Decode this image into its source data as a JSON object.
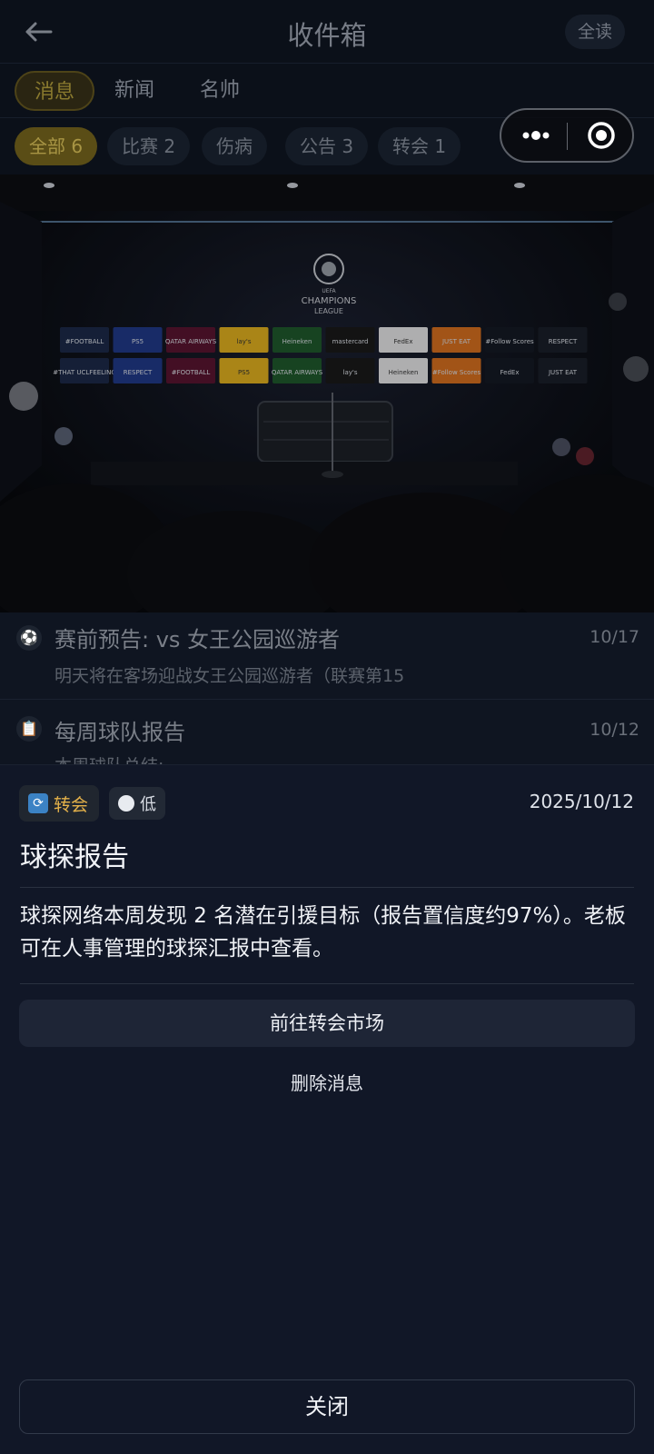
{
  "header": {
    "title": "收件箱",
    "read_all": "全读"
  },
  "tabs": [
    {
      "label": "消息",
      "active": true
    },
    {
      "label": "新闻",
      "active": false
    },
    {
      "label": "名帅",
      "active": false
    }
  ],
  "filters": [
    {
      "label": "全部 6",
      "active": true
    },
    {
      "label": "比赛 2",
      "active": false
    },
    {
      "label": "伤病",
      "active": false
    },
    {
      "label": "公告 3",
      "active": false
    },
    {
      "label": "转会 1",
      "active": false
    }
  ],
  "hero": {
    "league_line1": "UEFA",
    "league_line2": "CHAMPIONS",
    "league_line3": "LEAGUE",
    "sponsors_row1": [
      "#FOOTBALL",
      "PS5",
      "QATAR AIRWAYS",
      "lay's",
      "Heineken",
      "mastercard",
      "FedEx",
      "JUST EAT",
      "#Follow Scores",
      "RESPECT"
    ],
    "sponsors_row2": [
      "#THAT UCLFEELING",
      "RESPECT",
      "#FOOTBALL",
      "PS5",
      "QATAR AIRWAYS",
      "lay's",
      "Heineken",
      "#Follow Scores",
      "FedEx",
      "JUST EAT"
    ]
  },
  "messages": [
    {
      "icon": "soccer-ball-icon",
      "title": "赛前预告: vs 女王公园巡游者",
      "date": "10/17",
      "preview": "明天将在客场迎战女王公园巡游者（联赛第15"
    },
    {
      "icon": "clipboard-icon",
      "title": "每周球队报告",
      "date": "10/12",
      "preview": "本周球队总结:"
    }
  ],
  "detail": {
    "type_label": "转会",
    "priority_label": "低",
    "date": "2025/10/12",
    "title": "球探报告",
    "body": "球探网络本周发现 2 名潜在引援目标（报告置信度约97%）。老板可在人事管理的球探汇报中查看。",
    "action_label": "前往转会市场",
    "delete_label": "删除消息",
    "close_label": "关闭"
  },
  "colors": {
    "accent_gold": "#e5b24a",
    "sheet_bg": "#111727",
    "page_bg": "#0f1521",
    "transfer_icon": "#3b82c4"
  }
}
